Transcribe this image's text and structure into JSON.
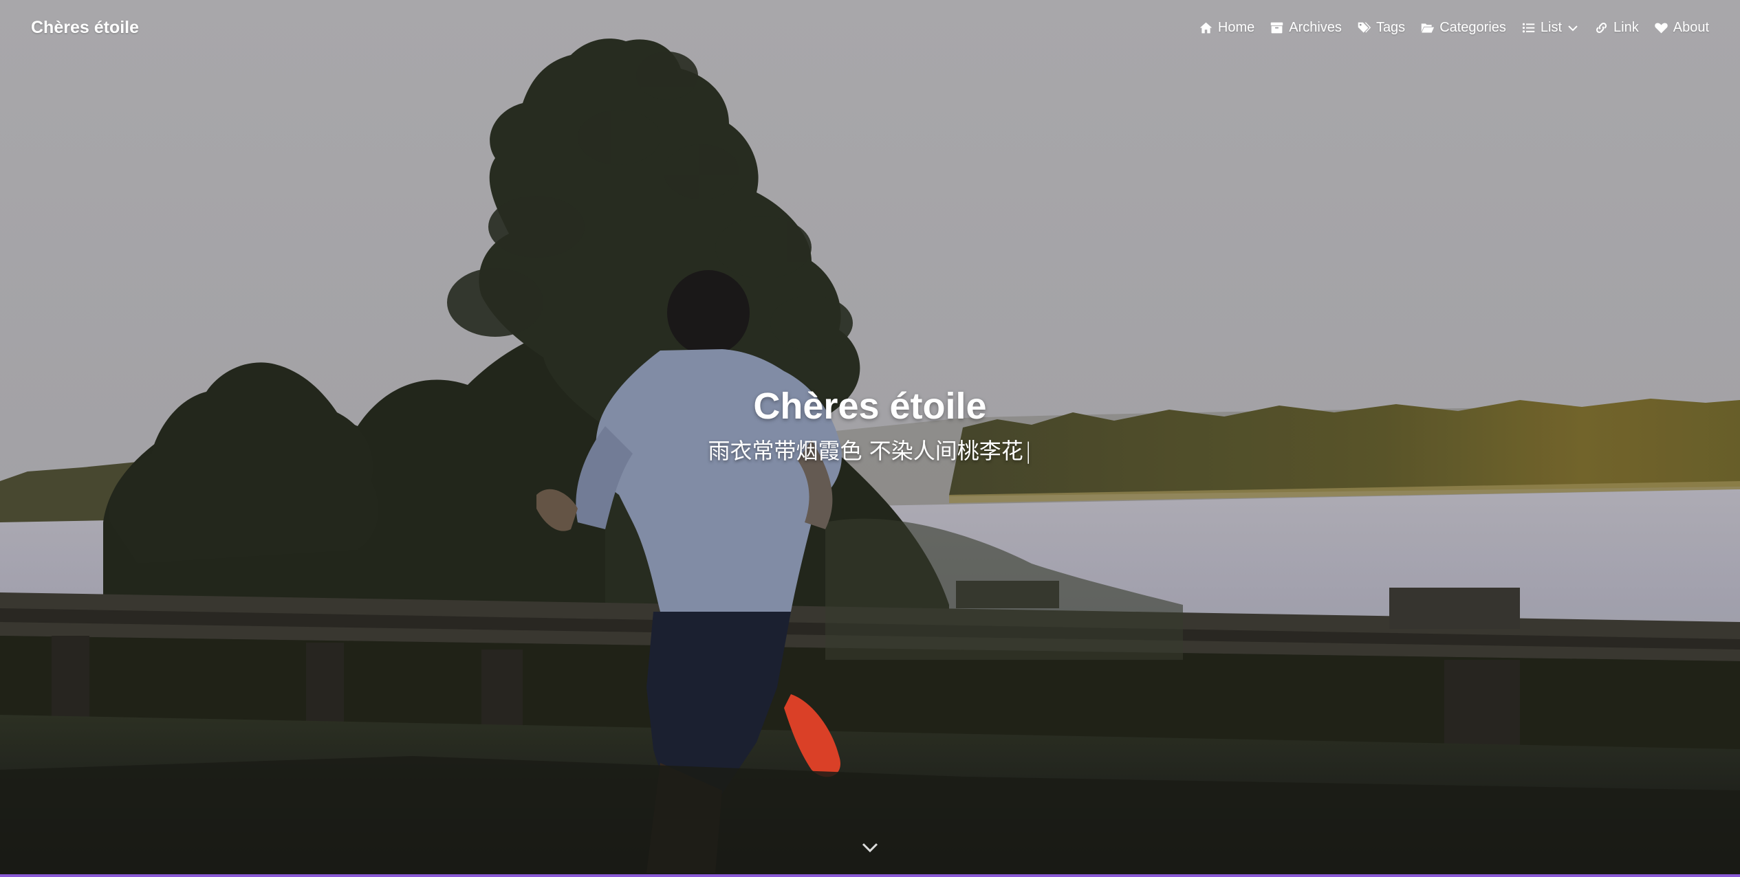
{
  "site": {
    "brand": "Chères étoile",
    "title": "Chères étoile",
    "subtitle": "雨衣常带烟霞色 不染人间桃李花",
    "cursor": "|"
  },
  "nav": {
    "items": [
      {
        "label": "Home",
        "icon": "home-icon"
      },
      {
        "label": "Archives",
        "icon": "archive-icon"
      },
      {
        "label": "Tags",
        "icon": "tags-icon"
      },
      {
        "label": "Categories",
        "icon": "folder-open-icon"
      },
      {
        "label": "List",
        "icon": "list-icon"
      },
      {
        "label": "Link",
        "icon": "link-icon"
      },
      {
        "label": "About",
        "icon": "heart-icon"
      }
    ]
  },
  "colors": {
    "accent": "#8a5ad6",
    "text": "#ffffff",
    "sky": "#b2b1b4"
  }
}
